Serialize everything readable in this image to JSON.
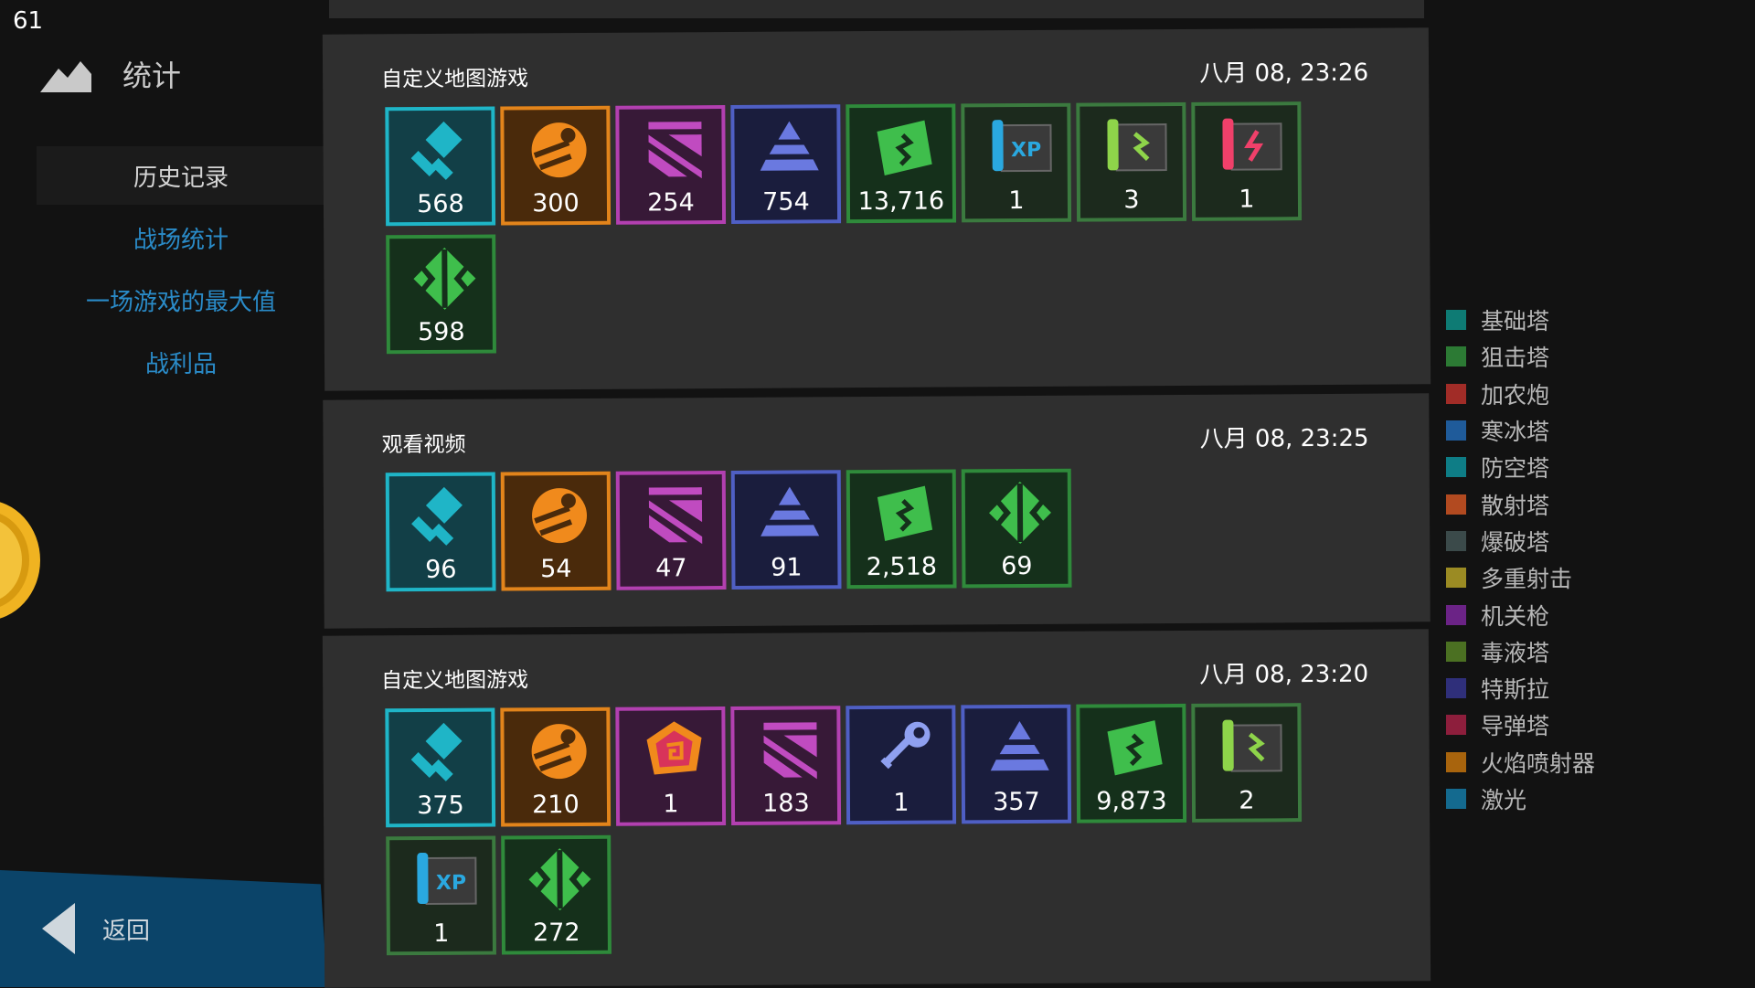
{
  "fps": "61",
  "sidebar": {
    "title": "统计",
    "items": [
      {
        "label": "历史记录"
      },
      {
        "label": "战场统计"
      },
      {
        "label": "一场游戏的最大值"
      },
      {
        "label": "战利品"
      }
    ],
    "back_label": "返回"
  },
  "cards": [
    {
      "title": "自定义地图游戏",
      "time": "八月 08, 23:26",
      "tiles": [
        {
          "icon": "enemies-killed-icon",
          "color": "cyan",
          "value": "568"
        },
        {
          "icon": "fast-enemy-icon",
          "color": "orange",
          "value": "300"
        },
        {
          "icon": "strong-enemy-icon",
          "color": "magenta",
          "value": "254"
        },
        {
          "icon": "armored-enemy-icon",
          "color": "blue",
          "value": "754"
        },
        {
          "icon": "money-icon",
          "color": "green",
          "value": "13,716"
        },
        {
          "icon": "xp-blueprint-icon",
          "color": "dgreen",
          "value": "1"
        },
        {
          "icon": "green-blueprint-icon",
          "color": "dgreen",
          "value": "3"
        },
        {
          "icon": "red-blueprint-icon",
          "color": "dgreen",
          "value": "1"
        },
        {
          "icon": "bit-dust-icon",
          "color": "green",
          "value": "598"
        }
      ]
    },
    {
      "title": "观看视频",
      "time": "八月 08, 23:25",
      "tiles": [
        {
          "icon": "enemies-killed-icon",
          "color": "cyan",
          "value": "96"
        },
        {
          "icon": "fast-enemy-icon",
          "color": "orange",
          "value": "54"
        },
        {
          "icon": "strong-enemy-icon",
          "color": "magenta",
          "value": "47"
        },
        {
          "icon": "armored-enemy-icon",
          "color": "blue",
          "value": "91"
        },
        {
          "icon": "money-icon",
          "color": "green",
          "value": "2,518"
        },
        {
          "icon": "bit-dust-icon",
          "color": "green",
          "value": "69"
        }
      ]
    },
    {
      "title": "自定义地图游戏",
      "time": "八月 08, 23:20",
      "tiles": [
        {
          "icon": "enemies-killed-icon",
          "color": "cyan",
          "value": "375"
        },
        {
          "icon": "fast-enemy-icon",
          "color": "orange",
          "value": "210"
        },
        {
          "icon": "boss-enemy-icon",
          "color": "magenta",
          "value": "1"
        },
        {
          "icon": "strong-enemy-icon",
          "color": "magenta",
          "value": "183"
        },
        {
          "icon": "key-icon",
          "color": "blue",
          "value": "1"
        },
        {
          "icon": "armored-enemy-icon",
          "color": "blue",
          "value": "357"
        },
        {
          "icon": "money-icon",
          "color": "green",
          "value": "9,873"
        },
        {
          "icon": "green-blueprint-icon",
          "color": "dgreen",
          "value": "2"
        },
        {
          "icon": "xp-blueprint-icon",
          "color": "dgreen",
          "value": "1"
        },
        {
          "icon": "bit-dust-icon",
          "color": "green",
          "value": "272"
        }
      ]
    }
  ],
  "legend": [
    {
      "label": "基础塔",
      "color": "#0e7b74"
    },
    {
      "label": "狙击塔",
      "color": "#2c7a34"
    },
    {
      "label": "加农炮",
      "color": "#a12c27"
    },
    {
      "label": "寒冰塔",
      "color": "#1f5b9a"
    },
    {
      "label": "防空塔",
      "color": "#0e7d86"
    },
    {
      "label": "散射塔",
      "color": "#b24a20"
    },
    {
      "label": "爆破塔",
      "color": "#3b4a4a"
    },
    {
      "label": "多重射击",
      "color": "#9b8b23"
    },
    {
      "label": "机关枪",
      "color": "#6b2386"
    },
    {
      "label": "毒液塔",
      "color": "#4b7022"
    },
    {
      "label": "特斯拉",
      "color": "#2f2f7a"
    },
    {
      "label": "导弹塔",
      "color": "#8d1e3c"
    },
    {
      "label": "火焰喷射器",
      "color": "#a8640d"
    },
    {
      "label": "激光",
      "color": "#146a8f"
    }
  ]
}
